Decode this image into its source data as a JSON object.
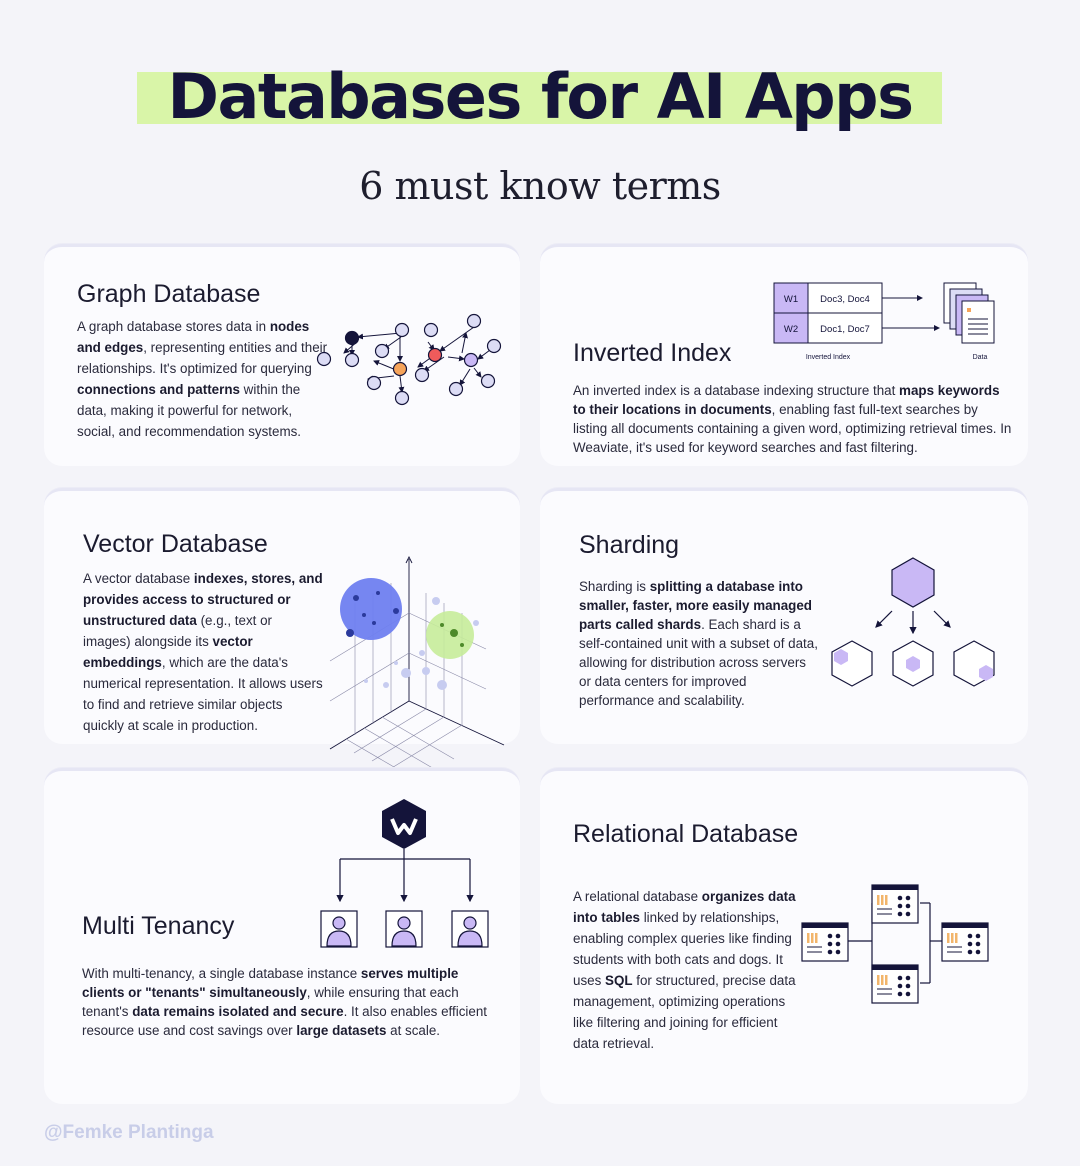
{
  "header": {
    "title": "Databases for AI Apps",
    "subtitle": "6 must know terms"
  },
  "cards": {
    "graph": {
      "title": "Graph Database",
      "body": [
        {
          "t": "A graph database stores data in ",
          "b": false
        },
        {
          "t": "nodes and edges",
          "b": true
        },
        {
          "t": ", representing entities and their relationships. It's optimized for querying ",
          "b": false
        },
        {
          "t": "connections and patterns",
          "b": true
        },
        {
          "t": " within the data, making it powerful for network, social, and recommendation systems.",
          "b": false
        }
      ]
    },
    "inverted": {
      "title": "Inverted Index",
      "body": [
        {
          "t": "An inverted index is a database indexing structure that ",
          "b": false
        },
        {
          "t": "maps keywords to their locations in documents",
          "b": true
        },
        {
          "t": ", enabling fast full-text searches by listing all documents containing a given word, optimizing retrieval times. In Weaviate, it's used for keyword searches and fast filtering.",
          "b": false
        }
      ],
      "table": {
        "rows": [
          {
            "key": "W1",
            "docs": "Doc3, Doc4"
          },
          {
            "key": "W2",
            "docs": "Doc1, Doc7"
          }
        ],
        "index_label": "Inverted Index",
        "data_label": "Data"
      }
    },
    "vector": {
      "title": "Vector Database",
      "body": [
        {
          "t": "A vector database ",
          "b": false
        },
        {
          "t": "indexes, stores, and provides access to structured or unstructured data",
          "b": true
        },
        {
          "t": " (e.g., text or images) alongside its ",
          "b": false
        },
        {
          "t": "vector embeddings",
          "b": true
        },
        {
          "t": ", which are the data's numerical representation. It allows users to find and retrieve similar objects quickly at scale in production.",
          "b": false
        }
      ]
    },
    "sharding": {
      "title": "Sharding",
      "body": [
        {
          "t": "Sharding is ",
          "b": false
        },
        {
          "t": "splitting a database into smaller, faster, more easily managed parts called shards",
          "b": true
        },
        {
          "t": ". Each shard is a self-contained unit with a subset of data, allowing for distribution across servers or data centers for improved performance and scalability.",
          "b": false
        }
      ]
    },
    "multi": {
      "title": "Multi Tenancy",
      "body": [
        {
          "t": "With multi-tenancy, a single database instance ",
          "b": false
        },
        {
          "t": "serves multiple clients or \"tenants\" simultaneously",
          "b": true
        },
        {
          "t": ", while ensuring that each tenant's ",
          "b": false
        },
        {
          "t": "data remains isolated and secure",
          "b": true
        },
        {
          "t": ". It also enables efficient resource use and cost savings over ",
          "b": false
        },
        {
          "t": "large datasets",
          "b": true
        },
        {
          "t": " at scale.",
          "b": false
        }
      ]
    },
    "relational": {
      "title": "Relational Database",
      "body": [
        {
          "t": "A relational database ",
          "b": false
        },
        {
          "t": "organizes data into tables",
          "b": true
        },
        {
          "t": " linked by relationships, enabling complex queries like finding students with both cats and dogs. It uses ",
          "b": false
        },
        {
          "t": "SQL",
          "b": true
        },
        {
          "t": " for structured, precise data management, optimizing operations like filtering and joining for efficient data retrieval.",
          "b": false
        }
      ]
    }
  },
  "footer": {
    "credit": "@Femke Plantinga"
  },
  "colors": {
    "title_highlight": "#d9f5a8",
    "purple": "#c9b8f5",
    "lavender": "#dcdcf5",
    "node_dark": "#14143a",
    "node_red": "#ef5b5b",
    "node_orange": "#f6a45a",
    "blue_cluster": "#6f7ff0",
    "green_cluster": "#c6ec9a",
    "table_orange": "#f2b56b"
  }
}
